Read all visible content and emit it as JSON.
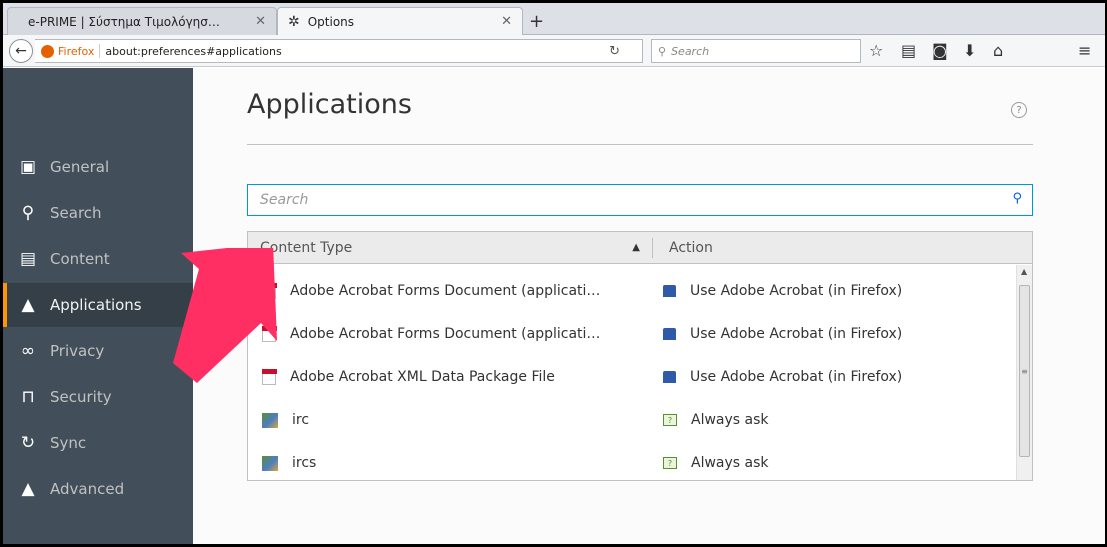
{
  "browser": {
    "tabs": [
      {
        "title": "e-PRIME | Σύστημα Τιμολόγησ…",
        "active": false
      },
      {
        "title": "Options",
        "active": true
      }
    ],
    "new_tab_label": "+",
    "identity_label": "Firefox",
    "url": "about:preferences#applications",
    "search_placeholder": "Search",
    "toolbar_icons": [
      "bookmark-star-icon",
      "reading-list-icon",
      "pocket-icon",
      "download-icon",
      "home-icon",
      "menu-icon"
    ]
  },
  "sidebar": {
    "items": [
      {
        "label": "General",
        "icon": "general-icon"
      },
      {
        "label": "Search",
        "icon": "search-icon"
      },
      {
        "label": "Content",
        "icon": "content-icon"
      },
      {
        "label": "Applications",
        "icon": "applications-icon",
        "selected": true
      },
      {
        "label": "Privacy",
        "icon": "privacy-mask-icon"
      },
      {
        "label": "Security",
        "icon": "lock-icon"
      },
      {
        "label": "Sync",
        "icon": "sync-icon"
      },
      {
        "label": "Advanced",
        "icon": "wizard-hat-icon"
      }
    ]
  },
  "main": {
    "title": "Applications",
    "help_symbol": "?",
    "filter_placeholder": "Search",
    "table": {
      "headers": {
        "type": "Content Type",
        "action": "Action"
      },
      "rows": [
        {
          "type": "Adobe Acrobat Forms Document (applicati…",
          "action": "Use Adobe Acrobat (in Firefox)",
          "type_icon": "pdf-icon",
          "action_icon": "adobe-acrobat-icon"
        },
        {
          "type": "Adobe Acrobat Forms Document (applicati…",
          "action": "Use Adobe Acrobat (in Firefox)",
          "type_icon": "pdf-icon",
          "action_icon": "adobe-acrobat-icon"
        },
        {
          "type": "Adobe Acrobat XML Data Package File",
          "action": "Use Adobe Acrobat (in Firefox)",
          "type_icon": "pdf-icon",
          "action_icon": "adobe-acrobat-icon"
        },
        {
          "type": "irc",
          "action": "Always ask",
          "type_icon": "irc-icon",
          "action_icon": "ask-icon"
        },
        {
          "type": "ircs",
          "action": "Always ask",
          "type_icon": "irc-icon",
          "action_icon": "ask-icon"
        }
      ]
    }
  },
  "colors": {
    "sidebar_bg": "#424f5a",
    "selected_accent": "#ff9500",
    "focus_border": "#0095dd",
    "annotation_arrow": "#ff2e63"
  }
}
